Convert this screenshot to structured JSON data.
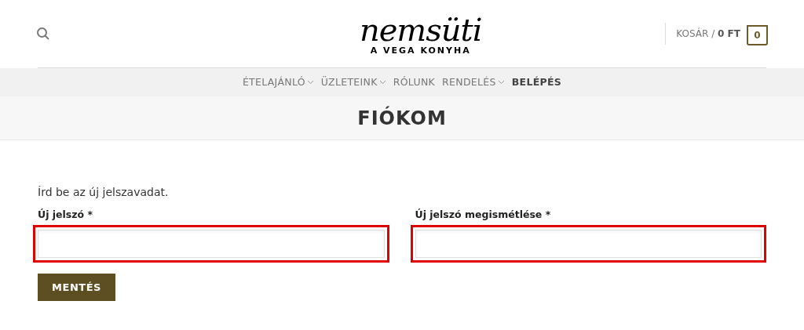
{
  "header": {
    "logo": {
      "name": "nemsüti",
      "tagline": "A VEGA KONYHA"
    },
    "cart": {
      "label": "KOSÁR /",
      "amount": "0 FT",
      "count": "0"
    }
  },
  "nav": [
    {
      "label": "ÉTELAJÁNLÓ",
      "dropdown": true,
      "selected": false
    },
    {
      "label": "ÜZLETEINK",
      "dropdown": true,
      "selected": false
    },
    {
      "label": "RÓLUNK",
      "dropdown": false,
      "selected": false
    },
    {
      "label": "RENDELÉS",
      "dropdown": true,
      "selected": false
    },
    {
      "label": "BELÉPÉS",
      "dropdown": false,
      "selected": true
    }
  ],
  "page_title": "FIÓKOM",
  "form": {
    "intro": "Írd be az új jelszavadat.",
    "fields": [
      {
        "label": "Új jelszó *",
        "highlighted": true
      },
      {
        "label": "Új jelszó megismétlése *",
        "highlighted": true
      }
    ],
    "submit": "MENTÉS"
  }
}
